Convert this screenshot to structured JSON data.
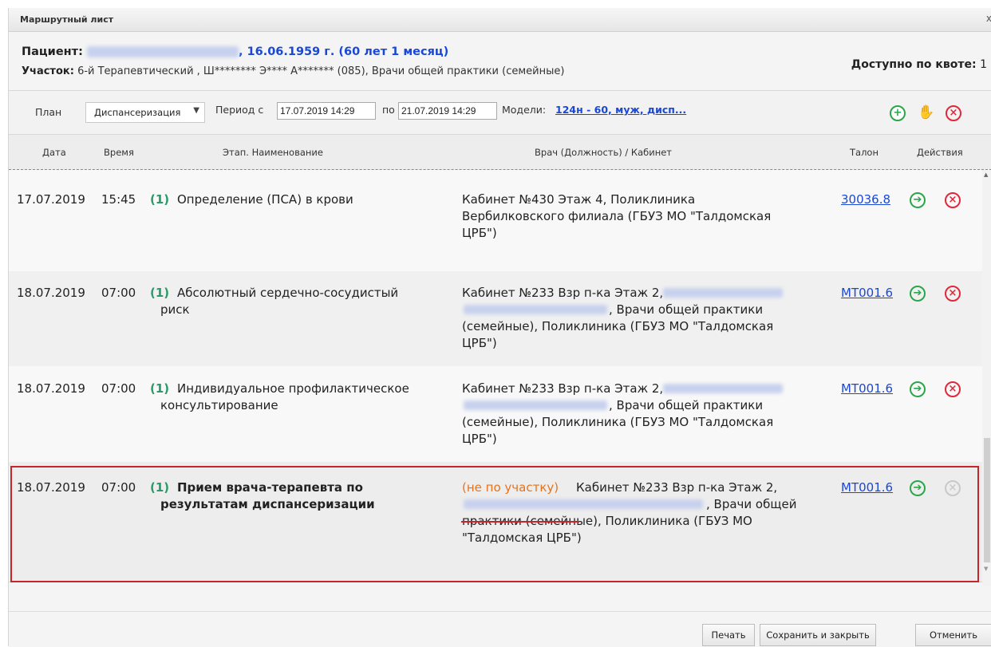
{
  "window": {
    "title": "Маршрутный лист",
    "close_glyph": "x"
  },
  "patient": {
    "label": "Пациент:",
    "birth": ", 16.06.1959 г. (60 лет 1 месяц)",
    "district_label": "Участок:",
    "district_value": "6-й Терапевтический , Ш******** Э**** А******* (085), Врачи общей практики (семейные)",
    "quota_label": "Доступно по квоте:",
    "quota_value": "1"
  },
  "toolbar": {
    "plan_label": "План",
    "plan_value": "Диспансеризация",
    "period_from_label": "Период с",
    "period_from": "17.07.2019 14:29",
    "period_to_label": "по",
    "period_to": "21.07.2019 14:29",
    "models_label": "Модели:",
    "models_link": "124н - 60, муж, дисп..."
  },
  "table": {
    "headers": {
      "date": "Дата",
      "time": "Время",
      "stage": "Этап. Наименование",
      "doctor": "Врач (Должность) / Кабинет",
      "talon": "Талон",
      "actions": "Действия"
    },
    "rows": [
      {
        "date": "17.07.2019",
        "time": "15:45",
        "num": "(1)",
        "name_lines": [
          "Определение (ПСА) в крови"
        ],
        "doctor_lines": [
          "Кабинет №430 Этаж 4, Поликлиника",
          "Вербилковского филиала (ГБУЗ МО \"Талдомская",
          "ЦРБ\")"
        ],
        "talon": "30036.8"
      },
      {
        "date": "18.07.2019",
        "time": "07:00",
        "num": "(1)",
        "name_lines": [
          "Абсолютный сердечно-сосудистый",
          "риск"
        ],
        "doctor_lines": [
          "Кабинет №233 Взр п-ка Этаж 2,",
          ", Врачи общей практики",
          "(семейные), Поликлиника (ГБУЗ МО \"Талдомская",
          "ЦРБ\")"
        ],
        "talon": "МТ001.6"
      },
      {
        "date": "18.07.2019",
        "time": "07:00",
        "num": "(1)",
        "name_lines": [
          "Индивидуальное профилактическое",
          "консультирование"
        ],
        "doctor_lines": [
          "Кабинет №233 Взр п-ка Этаж 2,",
          ", Врачи общей практики",
          "(семейные), Поликлиника (ГБУЗ МО \"Талдомская",
          "ЦРБ\")"
        ],
        "talon": "МТ001.6"
      },
      {
        "date": "18.07.2019",
        "time": "07:00",
        "num": "(1)",
        "name_lines": [
          "Прием врача-терапевта по",
          "результатам диспансеризации"
        ],
        "warning": "(не по участку)",
        "doctor_lines": [
          " Кабинет №233 Взр п-ка Этаж 2,",
          ", Врачи общей",
          "практики (семейные), Поликлиника (ГБУЗ МО",
          "\"Талдомская ЦРБ\")"
        ],
        "talon": "МТ001.6"
      }
    ]
  },
  "footer": {
    "print": "Печать",
    "save_close": "Сохранить и закрыть",
    "cancel": "Отменить"
  },
  "colors": {
    "accent_blue": "#1a48d6",
    "green": "#2aa64a",
    "red": "#e0283a",
    "warning_orange": "#e8721c",
    "highlight_red": "#c8252b"
  }
}
